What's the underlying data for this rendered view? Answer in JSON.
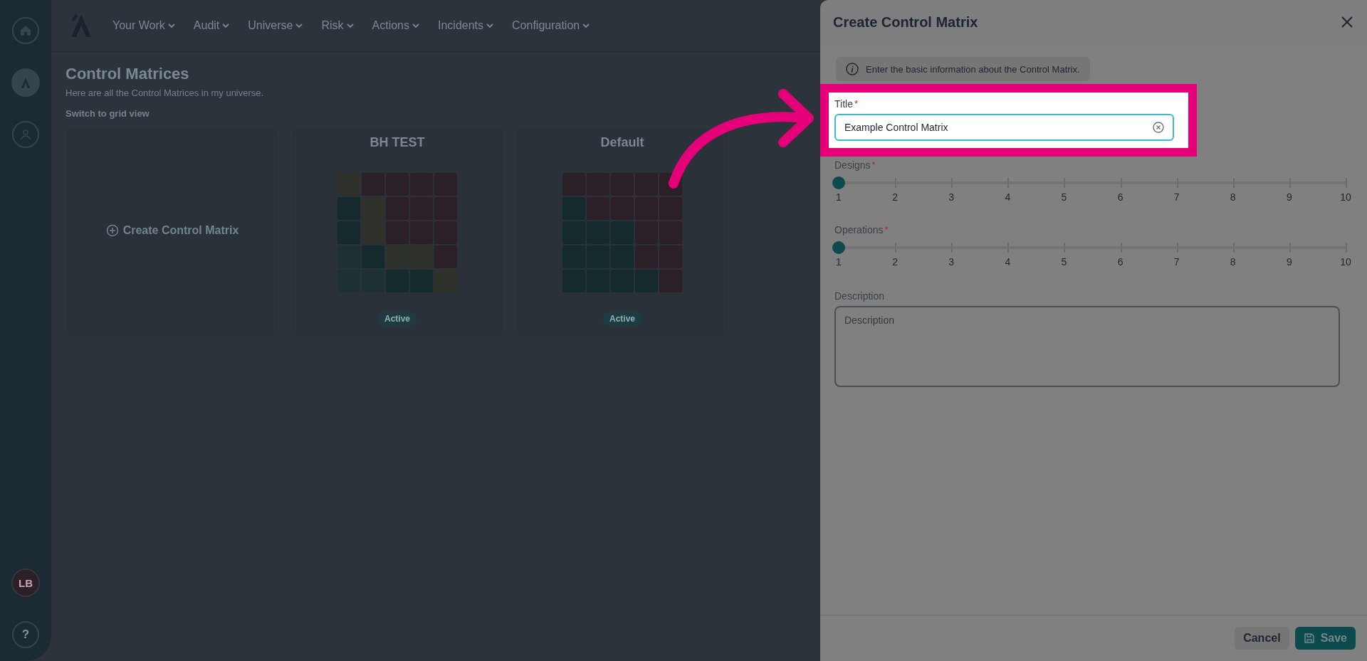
{
  "sidebar": {
    "avatar": "LB",
    "help": "?"
  },
  "nav": {
    "items": [
      "Your Work",
      "Audit",
      "Universe",
      "Risk",
      "Actions",
      "Incidents",
      "Configuration"
    ]
  },
  "page": {
    "title": "Control Matrices",
    "subtitle": "Here are all the Control Matrices in my universe.",
    "view_toggle": "Switch to grid view"
  },
  "cards": [
    {
      "kind": "create",
      "label": "Create Control Matrix"
    },
    {
      "kind": "matrix",
      "title": "BH TEST",
      "status": "Active",
      "rows": [
        {
          "cells": [
            {
              "color": "#2f312b"
            },
            {
              "color": "#2b1f28"
            },
            {
              "color": "#2b1f28"
            },
            {
              "color": "#2b1f28"
            },
            {
              "color": "#2b1f28"
            }
          ]
        },
        {
          "cells": [
            {
              "color": "#142a2d"
            },
            {
              "color": "#2f312b"
            },
            {
              "color": "#2b1f28"
            },
            {
              "color": "#2b1f28"
            },
            {
              "color": "#2b1f28"
            }
          ]
        },
        {
          "cells": [
            {
              "color": "#142a2d"
            },
            {
              "color": "#2f312b"
            },
            {
              "color": "#2b1f28"
            },
            {
              "color": "#2b1f28"
            },
            {
              "color": "#2b1f28"
            }
          ]
        },
        {
          "cells": [
            {
              "color": "#1d3134"
            },
            {
              "color": "#142a2d"
            },
            {
              "color": "#2f312b"
            },
            {
              "color": "#2f312b"
            },
            {
              "color": "#2b1f28"
            }
          ]
        },
        {
          "cells": [
            {
              "color": "#1d3134"
            },
            {
              "color": "#1d3134"
            },
            {
              "color": "#142a2d"
            },
            {
              "color": "#142a2d"
            },
            {
              "color": "#2f312b"
            }
          ]
        }
      ]
    },
    {
      "kind": "matrix",
      "title": "Default",
      "status": "Active",
      "rows": [
        {
          "cells": [
            {
              "color": "#2b1f28"
            },
            {
              "color": "#2b1f28"
            },
            {
              "color": "#2b1f28"
            },
            {
              "color": "#2b1f28"
            },
            {
              "color": "#2b1f28"
            }
          ]
        },
        {
          "cells": [
            {
              "color": "#142a2d"
            },
            {
              "color": "#2b1f28"
            },
            {
              "color": "#2b1f28"
            },
            {
              "color": "#2b1f28"
            },
            {
              "color": "#2b1f28"
            }
          ]
        },
        {
          "cells": [
            {
              "color": "#142a2d"
            },
            {
              "color": "#142a2d"
            },
            {
              "color": "#142a2d"
            },
            {
              "color": "#2b1f28"
            },
            {
              "color": "#2b1f28"
            }
          ]
        },
        {
          "cells": [
            {
              "color": "#142a2d"
            },
            {
              "color": "#142a2d"
            },
            {
              "color": "#142a2d"
            },
            {
              "color": "#2b1f28"
            },
            {
              "color": "#2b1f28"
            }
          ]
        },
        {
          "cells": [
            {
              "color": "#142a2d"
            },
            {
              "color": "#142a2d"
            },
            {
              "color": "#142a2d"
            },
            {
              "color": "#142a2d"
            },
            {
              "color": "#2b1f28"
            }
          ]
        }
      ]
    }
  ],
  "drawer": {
    "title": "Create Control Matrix",
    "info": "Enter the basic information about the Control Matrix.",
    "fields": [
      {
        "kind": "text",
        "label": "Title",
        "required_mark": "*",
        "value": "Example Control Matrix",
        "highlighted": true
      },
      {
        "kind": "slider",
        "label": "Designs",
        "required_mark": "*",
        "level": 0,
        "ticks": [
          "1",
          "2",
          "3",
          "4",
          "5",
          "6",
          "7",
          "8",
          "9",
          "10"
        ]
      },
      {
        "kind": "slider",
        "label": "Operations",
        "required_mark": "*",
        "level": 0,
        "ticks": [
          "1",
          "2",
          "3",
          "4",
          "5",
          "6",
          "7",
          "8",
          "9",
          "10"
        ]
      },
      {
        "kind": "textarea",
        "label": "Description",
        "placeholder": "Description"
      }
    ],
    "buttons": [
      {
        "kind": "secondary",
        "label": "Cancel"
      },
      {
        "kind": "primary",
        "label": "Save"
      }
    ]
  }
}
